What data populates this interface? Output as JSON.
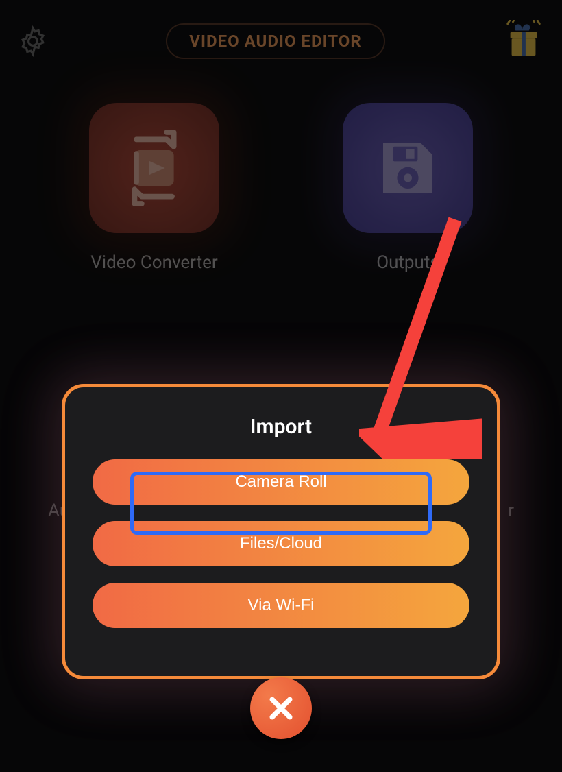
{
  "header": {
    "title": "VIDEO AUDIO EDITOR"
  },
  "tiles": {
    "video_converter": "Video Converter",
    "outputs": "Outputs"
  },
  "modal": {
    "title": "Import",
    "camera_roll": "Camera Roll",
    "files_cloud": "Files/Cloud",
    "via_wifi": "Via Wi-Fi"
  },
  "bg_text": {
    "left": "Au",
    "right": "r"
  },
  "annotations": {
    "arrow_target": "camera-roll-button",
    "highlight_target": "camera-roll-button"
  }
}
